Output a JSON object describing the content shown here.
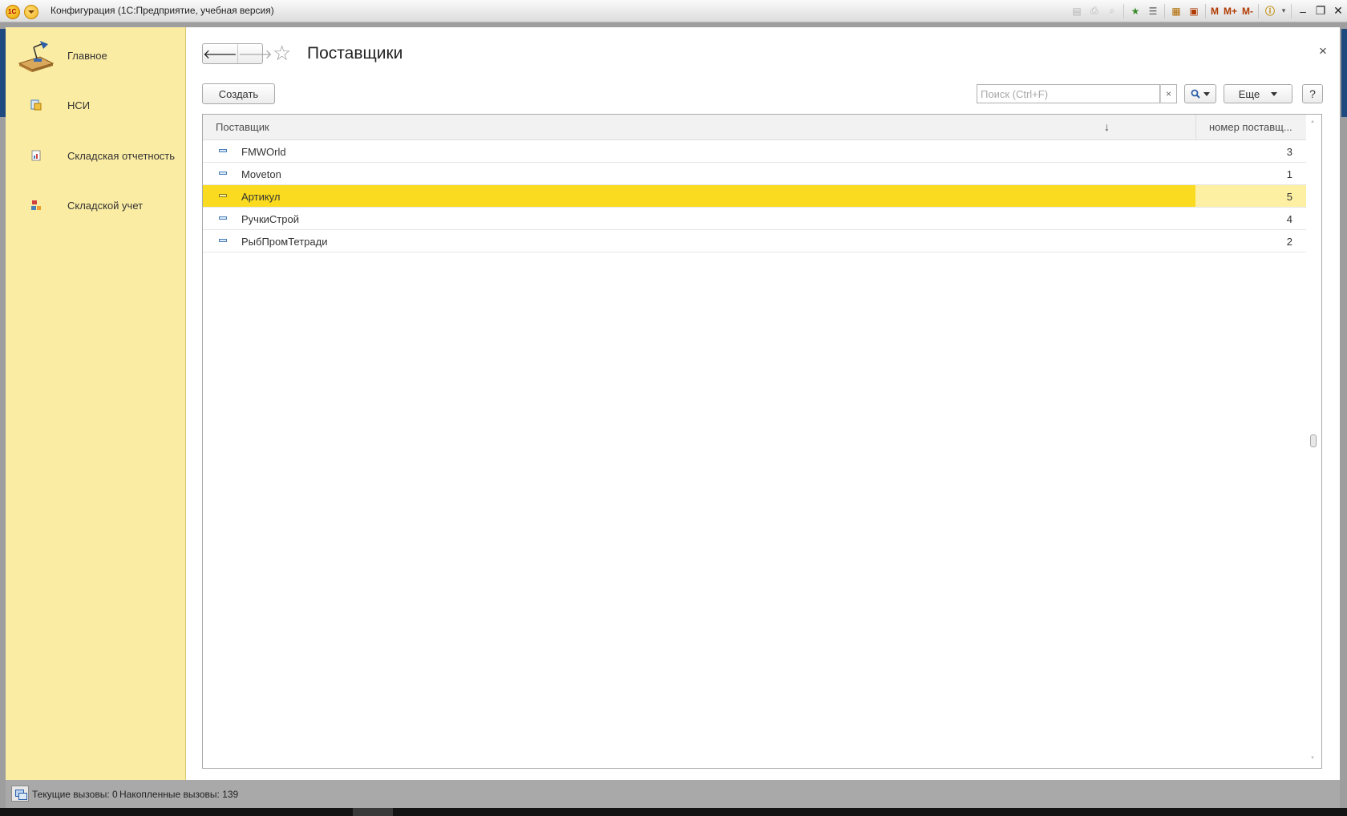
{
  "window": {
    "title": "Конфигурация  (1С:Предприятие, учебная версия)",
    "toolbar_m_labels": [
      "M",
      "M+",
      "M-"
    ]
  },
  "sidebar": {
    "items": [
      {
        "label": "Главное",
        "icon": "desk-lamp-icon"
      },
      {
        "label": "НСИ",
        "icon": "reference-data-icon"
      },
      {
        "label": "Складская отчетность",
        "icon": "report-icon"
      },
      {
        "label": "Складской учет",
        "icon": "warehouse-icon"
      }
    ]
  },
  "form": {
    "title": "Поставщики",
    "close_symbol": "×",
    "create_label": "Создать",
    "search_placeholder": "Поиск (Ctrl+F)",
    "search_value": "",
    "search_clear": "×",
    "more_label": "Еще",
    "help_label": "?"
  },
  "table": {
    "columns": [
      "Поставщик",
      "номер поставщ..."
    ],
    "sort_indicator": "↓",
    "rows": [
      {
        "name": "FMWOrld",
        "number": "3",
        "selected": false
      },
      {
        "name": "Moveton",
        "number": "1",
        "selected": false
      },
      {
        "name": "Артикул",
        "number": "5",
        "selected": true
      },
      {
        "name": "РучкиСтрой",
        "number": "4",
        "selected": false
      },
      {
        "name": "РыбПромТетради",
        "number": "2",
        "selected": false
      }
    ]
  },
  "status": {
    "current_calls": "Текущие вызовы: 0",
    "accumulated_calls": "Накопленные вызовы: 139"
  },
  "colors": {
    "sidebar_bg": "#fbeca3",
    "selected_row": "#fadb1f",
    "selected_cell": "#fdf0a3"
  }
}
